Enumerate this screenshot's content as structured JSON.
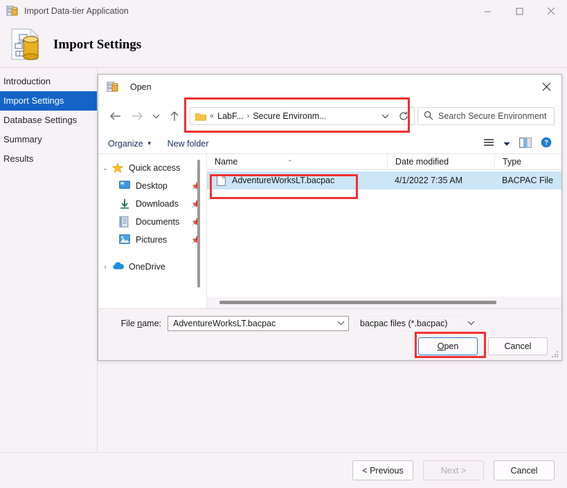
{
  "wizard": {
    "title": "Import Data-tier Application",
    "title_icon": "app-icon",
    "header_title": "Import Settings",
    "window_controls": {
      "minimize": "minimize-icon",
      "maximize": "maximize-icon",
      "close": "close-icon"
    },
    "nav": [
      {
        "label": "Introduction",
        "active": false
      },
      {
        "label": "Import Settings",
        "active": true
      },
      {
        "label": "Database Settings",
        "active": false
      },
      {
        "label": "Summary",
        "active": false
      },
      {
        "label": "Results",
        "active": false
      }
    ],
    "footer": {
      "previous": "< Previous",
      "next": "Next >",
      "next_disabled": true,
      "cancel": "Cancel"
    }
  },
  "dialog": {
    "title": "Open",
    "close": "✕",
    "nav": {
      "back": "←",
      "forward": "→",
      "recent": "˅",
      "up": "↑"
    },
    "address": {
      "leading": "«",
      "crumb1": "LabF...",
      "separator": "›",
      "crumb2": "Secure Environm...",
      "dropdown": "˅",
      "refresh": "refresh-icon"
    },
    "search": {
      "placeholder": "Search Secure Environment",
      "icon": "search-icon"
    },
    "toolbar": {
      "organize": "Organize",
      "organize_caret": "▼",
      "new_folder": "New folder",
      "view_icon": "view-list-icon",
      "view_caret": "▼",
      "preview_icon": "preview-pane-icon",
      "help_icon": "help-icon"
    },
    "tree": [
      {
        "label": "Quick access",
        "chevron": "⌄",
        "icon": "star-icon",
        "indent": false,
        "pinned": false
      },
      {
        "label": "Desktop",
        "chevron": "",
        "icon": "desktop-icon",
        "indent": true,
        "pinned": true
      },
      {
        "label": "Downloads",
        "chevron": "",
        "icon": "downloads-icon",
        "indent": true,
        "pinned": true
      },
      {
        "label": "Documents",
        "chevron": "",
        "icon": "documents-icon",
        "indent": true,
        "pinned": true
      },
      {
        "label": "Pictures",
        "chevron": "",
        "icon": "pictures-icon",
        "indent": true,
        "pinned": true
      },
      {
        "label": "OneDrive",
        "chevron": "›",
        "icon": "cloud-icon",
        "indent": false,
        "pinned": false
      }
    ],
    "columns": {
      "name": "Name",
      "date_modified": "Date modified",
      "type": "Type",
      "sort_caret": "⌃"
    },
    "files": [
      {
        "name": "AdventureWorksLT.bacpac",
        "date_modified": "4/1/2022 7:35 AM",
        "type": "BACPAC File",
        "selected": true,
        "icon": "file-icon"
      }
    ],
    "filename": {
      "label_pre": "File ",
      "label_key": "n",
      "label_post": "ame:",
      "value": "AdventureWorksLT.bacpac",
      "caret": "˅"
    },
    "filter": {
      "value": "bacpac files (*.bacpac)",
      "caret": "˅"
    },
    "buttons": {
      "open_pre": "O",
      "open_post": "pen",
      "open": "Open",
      "cancel": "Cancel"
    }
  },
  "annotations": {
    "colors": {
      "highlight": "#f03030",
      "accent": "#1464c8",
      "selection": "#cce5f7"
    },
    "boxes": [
      {
        "name": "address-bar-highlight"
      },
      {
        "name": "file-row-highlight"
      },
      {
        "name": "open-button-highlight"
      }
    ]
  }
}
